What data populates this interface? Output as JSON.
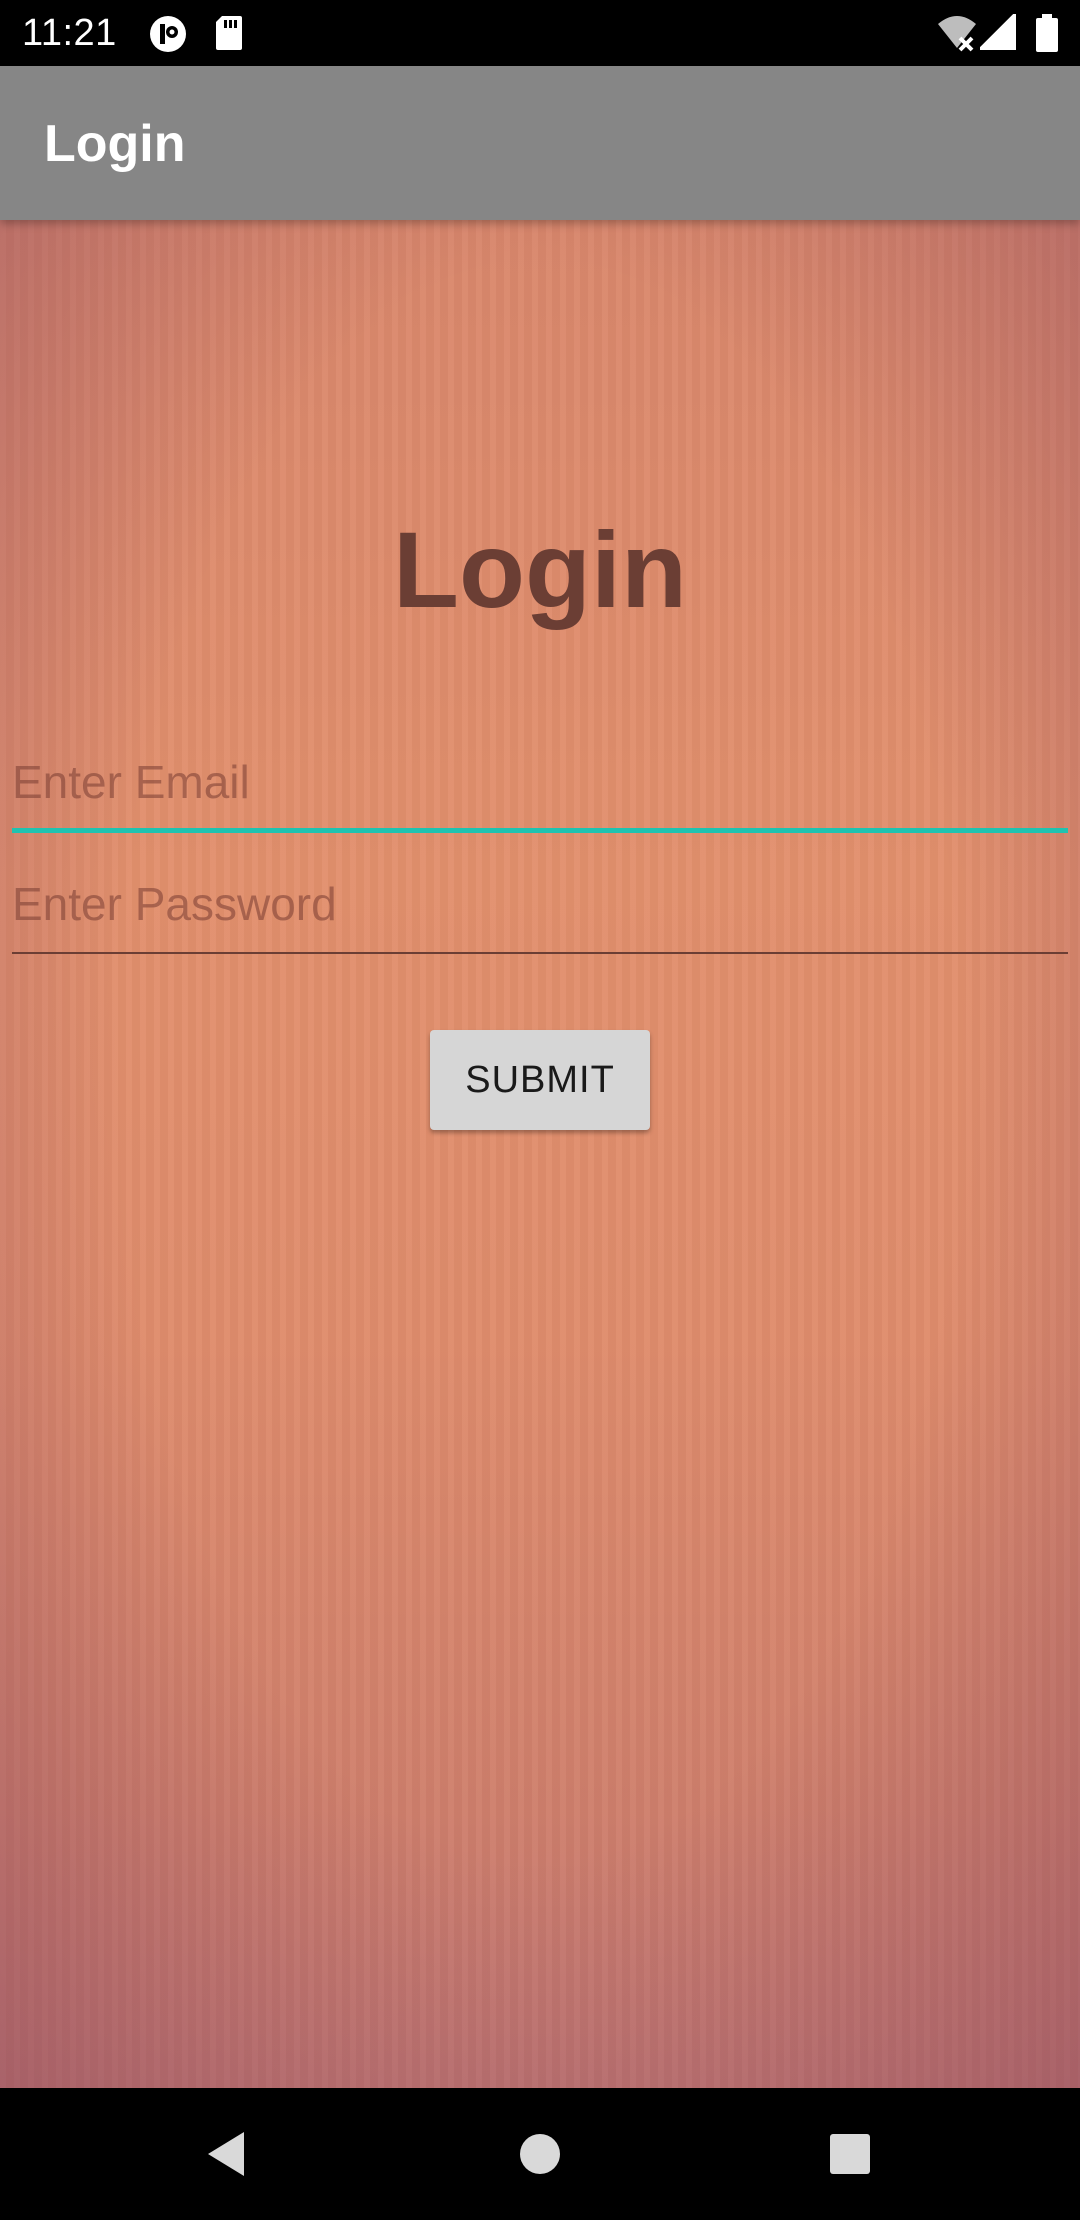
{
  "status_bar": {
    "time": "11:21"
  },
  "app_bar": {
    "title": "Login"
  },
  "login_form": {
    "heading": "Login",
    "email_placeholder": "Enter Email",
    "password_placeholder": "Enter Password",
    "submit_label": "SUBMIT"
  },
  "colors": {
    "app_bar_bg": "#868686",
    "heading_color": "#6b3e34",
    "focused_underline": "#1fc3b0",
    "button_bg": "#d6d6d6"
  },
  "icons": {
    "status_left": [
      "notification-app-icon",
      "sd-card-icon"
    ],
    "status_right": [
      "wifi-off-icon",
      "signal-icon",
      "battery-icon"
    ],
    "nav": [
      "back-icon",
      "home-icon",
      "recents-icon"
    ]
  }
}
